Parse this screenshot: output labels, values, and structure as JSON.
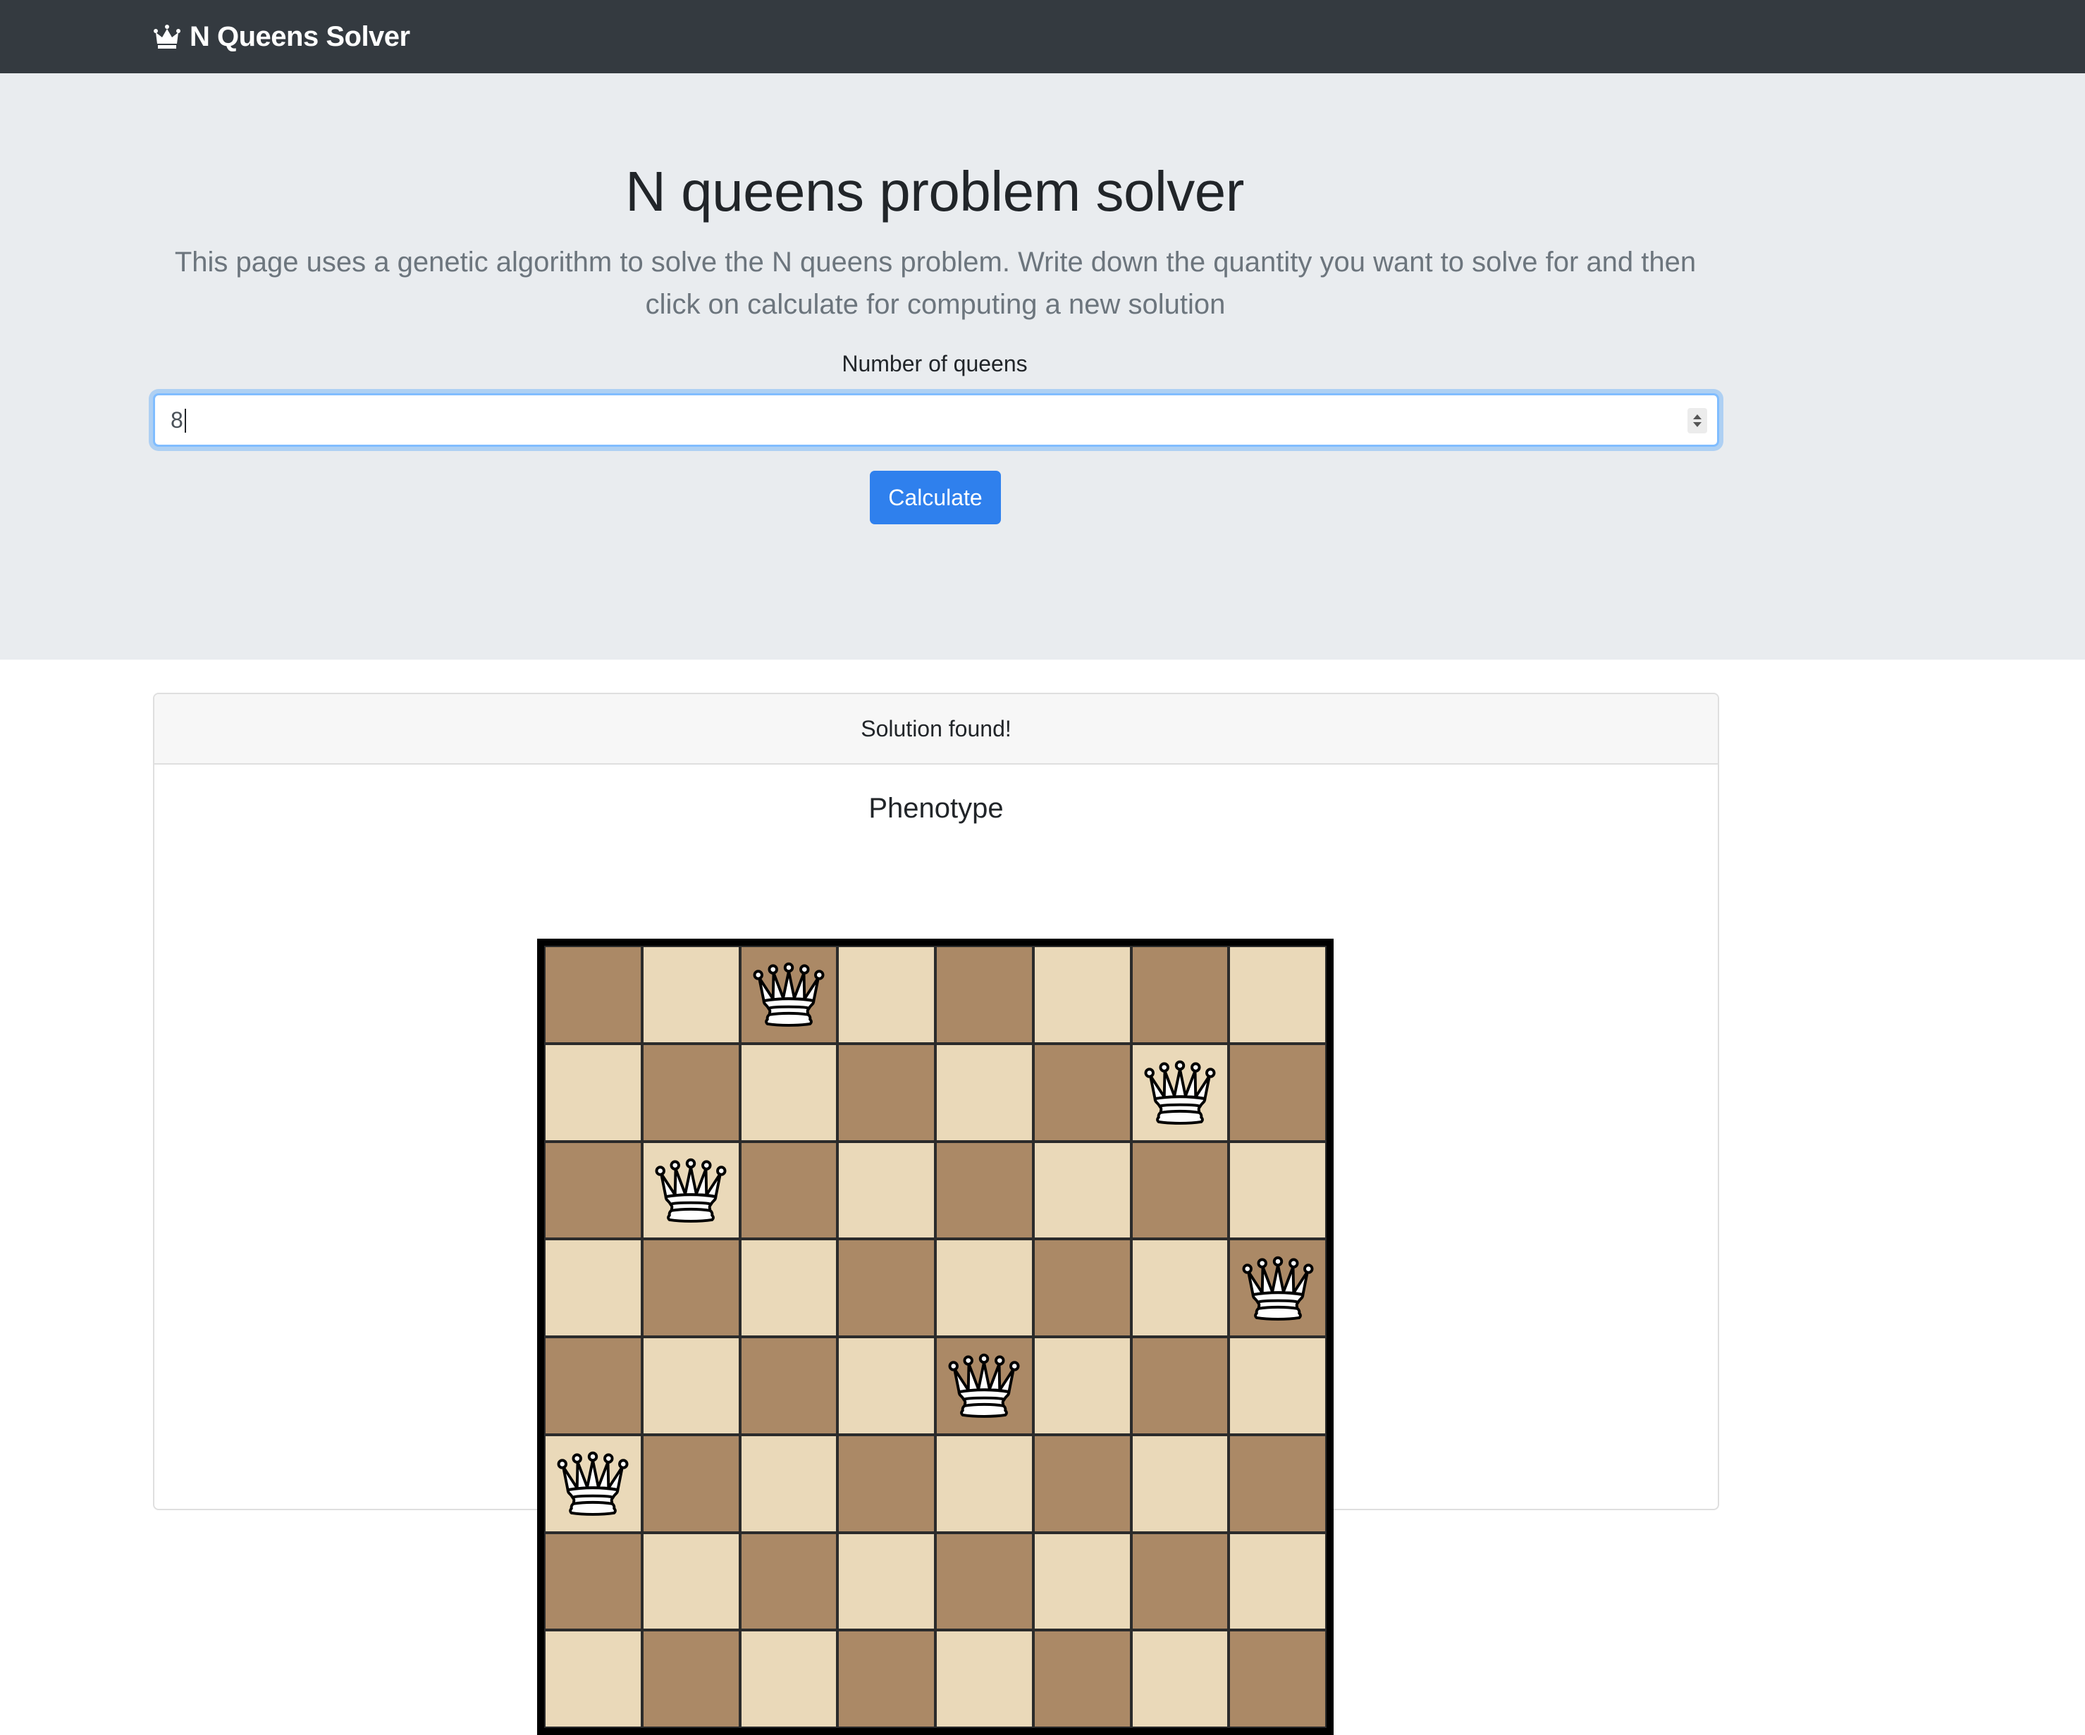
{
  "navbar": {
    "brand": "N Queens Solver",
    "brand_icon": "crown-icon"
  },
  "hero": {
    "title": "N queens problem solver",
    "description": "This page uses a genetic algorithm to solve the N queens problem. Write down the quantity you want to solve for and then click on calculate for computing a new solution",
    "input_label": "Number of queens",
    "input_value": "8",
    "button_label": "Calculate"
  },
  "result": {
    "header": "Solution found!",
    "title": "Phenotype",
    "board": {
      "size": 8,
      "queen_columns_by_row": [
        2,
        6,
        1,
        7,
        4,
        0
      ],
      "colors": {
        "light": "#ead9b9",
        "dark": "#ab8966",
        "border": "#000000"
      }
    }
  },
  "colors": {
    "navbar": "#343a40",
    "jumbotron": "#e9ecef",
    "primary": "#2f80ed"
  }
}
